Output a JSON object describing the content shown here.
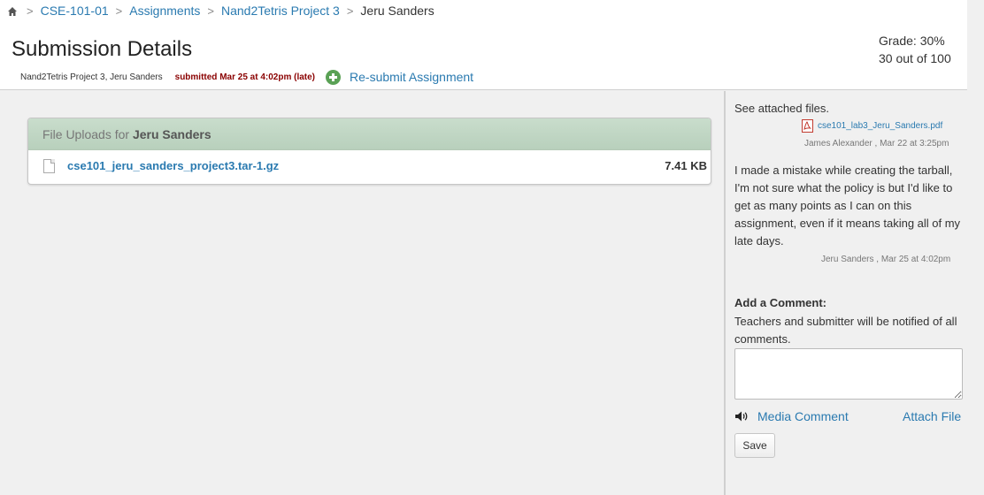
{
  "breadcrumb": {
    "items": [
      "CSE-101-01",
      "Assignments",
      "Nand2Tetris Project 3"
    ],
    "current": "Jeru Sanders"
  },
  "header": {
    "title": "Submission Details",
    "submission_info": "Nand2Tetris Project 3, Jeru Sanders",
    "status": "submitted Mar 25 at 4:02pm (late)",
    "resubmit_label": "Re-submit Assignment",
    "grade_line": "Grade: 30%",
    "points_line": "30 out of 100"
  },
  "uploads": {
    "heading_prefix": "File Uploads for",
    "student": "Jeru Sanders",
    "files": [
      {
        "name": "cse101_jeru_sanders_project3.tar-1.gz",
        "size": "7.41 KB"
      }
    ]
  },
  "comments": [
    {
      "text": "See attached files.",
      "attachment": "cse101_lab3_Jeru_Sanders.pdf",
      "author": "James Alexander",
      "date": "Mar 22 at 3:25pm"
    },
    {
      "text": "I made a mistake while creating the tarball, I'm not sure what the policy is but I'd like to get as many points as I can on this assignment, even if it means taking all of my late days.",
      "author": "Jeru Sanders",
      "date": "Mar 25 at 4:02pm"
    }
  ],
  "add_comment": {
    "heading": "Add a Comment:",
    "notice": "Teachers and submitter will be notified of all comments.",
    "placeholder": "",
    "media_label": "Media Comment",
    "attach_label": "Attach File",
    "save_label": "Save"
  },
  "colors": {
    "link": "#2a7ab0",
    "late": "#8a0000",
    "upload_header": "#c2d8c6",
    "resubmit_icon": "#5aa155"
  }
}
